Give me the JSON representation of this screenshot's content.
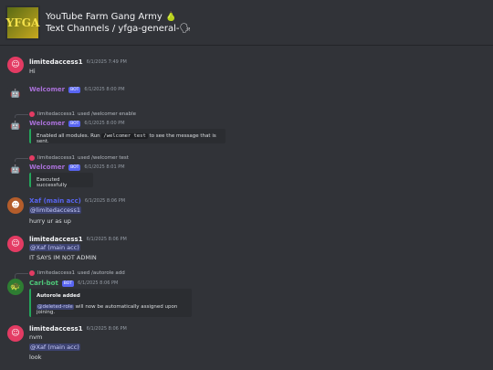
{
  "server": {
    "logo_text": "YFGA",
    "name": "YouTube Farm Gang Army 🍐",
    "breadcrumb": "Text Channels / yfga-general-🗣"
  },
  "messages": [
    {
      "id": "m1",
      "author": "limitedaccess1",
      "time": "6/1/2025 7:49 PM",
      "text": "Hi"
    },
    {
      "id": "m2",
      "author": "Welcomer",
      "badge": "BOT",
      "time": "6/1/2025 8:00 PM"
    },
    {
      "id": "m3",
      "reply_user": "limitedaccess1",
      "reply_text": "used /welcomer enable",
      "author": "Welcomer",
      "badge": "BOT",
      "time": "6/1/2025 8:00 PM",
      "embed_pre": "Enabled all modules. Run ",
      "embed_code": "/welcomer test",
      "embed_post": " to see the message that is sent."
    },
    {
      "id": "m4",
      "reply_user": "limitedaccess1",
      "reply_text": "used /welcomer test",
      "author": "Welcomer",
      "badge": "BOT",
      "time": "6/1/2025 8:01 PM",
      "embed_text": "Executed successfully"
    },
    {
      "id": "m5",
      "author": "Xaf (main acc)",
      "time": "6/1/2025 8:06 PM",
      "mention": "@limitedaccess1",
      "text": "hurry ur as up"
    },
    {
      "id": "m6",
      "author": "limitedaccess1",
      "time": "6/1/2025 8:06 PM",
      "mention": "@Xaf (main acc)",
      "text": "IT SAYS IM NOT ADMIN"
    },
    {
      "id": "m7",
      "reply_user": "limitedaccess1",
      "reply_text": "used /autorole add",
      "author": "Carl-bot",
      "badge": "BOT",
      "time": "6/1/2025 8:06 PM",
      "embed_title": "Autorole added",
      "embed_mention": "@deleted-role",
      "embed_post": " will now be automatically assigned upon joining."
    },
    {
      "id": "m8",
      "author": "limitedaccess1",
      "time": "6/1/2025 8:06 PM",
      "text": "nvm",
      "mention": "@Xaf (main acc)",
      "text2": "look"
    }
  ]
}
